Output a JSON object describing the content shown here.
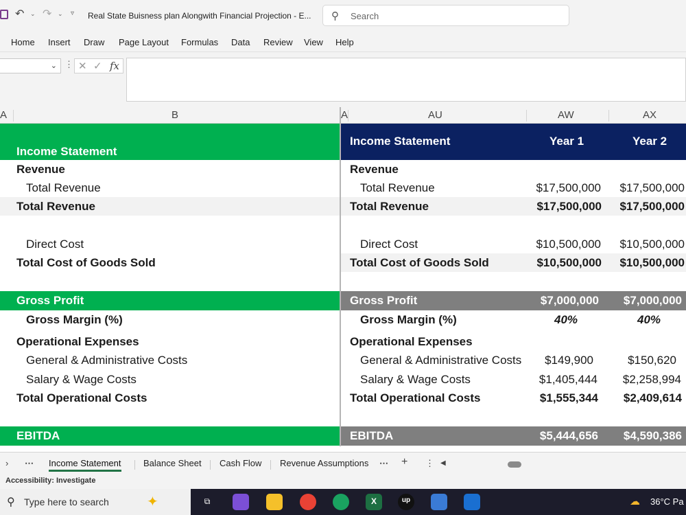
{
  "titlebar": {
    "doc_title": "Real State Buisness plan Alongwith Financial Projection  -  E...",
    "search_placeholder": "Search"
  },
  "ribbon": {
    "tabs": [
      "Home",
      "Insert",
      "Draw",
      "Page Layout",
      "Formulas",
      "Data",
      "Review",
      "View",
      "Help"
    ]
  },
  "formula_bar": {
    "fx_label": "fx"
  },
  "columns": {
    "a_left": "A",
    "b": "B",
    "a_right": "A",
    "au": "AU",
    "aw": "AW",
    "ax": "AX"
  },
  "colors": {
    "green": "#00b050",
    "navy": "#0b2161",
    "gray_band": "#7f7f7f",
    "light_band": "#f2f2f2"
  },
  "left_pane": {
    "header": "Income Statement",
    "revenue": "Revenue",
    "total_revenue_item": "Total Revenue",
    "total_revenue": "Total Revenue",
    "direct_cost": "Direct Cost",
    "total_cogs": "Total Cost of Goods Sold",
    "gross_profit": "Gross Profit",
    "gross_margin": "Gross Margin (%)",
    "opex": "Operational Expenses",
    "gna": "General & Administrative Costs",
    "salary": "Salary & Wage Costs",
    "total_opex": "Total Operational Costs",
    "ebitda": "EBITDA"
  },
  "right_pane": {
    "header": "Income Statement",
    "year1": "Year 1",
    "year2": "Year 2",
    "revenue": "Revenue",
    "total_revenue_item": "Total Revenue",
    "total_revenue_item_y1": "$17,500,000",
    "total_revenue_item_y2": "$17,500,000",
    "total_revenue": "Total Revenue",
    "total_revenue_y1": "$17,500,000",
    "total_revenue_y2": "$17,500,000",
    "direct_cost": "Direct Cost",
    "direct_cost_y1": "$10,500,000",
    "direct_cost_y2": "$10,500,000",
    "total_cogs": "Total Cost of Goods Sold",
    "total_cogs_y1": "$10,500,000",
    "total_cogs_y2": "$10,500,000",
    "gross_profit": "Gross Profit",
    "gross_profit_y1": "$7,000,000",
    "gross_profit_y2": "$7,000,000",
    "gross_margin": "Gross Margin (%)",
    "gross_margin_y1": "40%",
    "gross_margin_y2": "40%",
    "opex": "Operational Expenses",
    "gna": "General & Administrative Costs",
    "gna_y1": "$149,900",
    "gna_y2": "$150,620",
    "salary": "Salary & Wage Costs",
    "salary_y1": "$1,405,444",
    "salary_y2": "$2,258,994",
    "total_opex": "Total Operational Costs",
    "total_opex_y1": "$1,555,344",
    "total_opex_y2": "$2,409,614",
    "ebitda": "EBITDA",
    "ebitda_y1": "$5,444,656",
    "ebitda_y2": "$4,590,386"
  },
  "sheet_tabs": [
    "Income Statement",
    "Balance Sheet",
    "Cash Flow",
    "Revenue Assumptions"
  ],
  "status": {
    "accessibility": "Accessibility: Investigate"
  },
  "taskbar": {
    "search_placeholder": "Type here to search",
    "temperature": "36°C  Pa"
  }
}
